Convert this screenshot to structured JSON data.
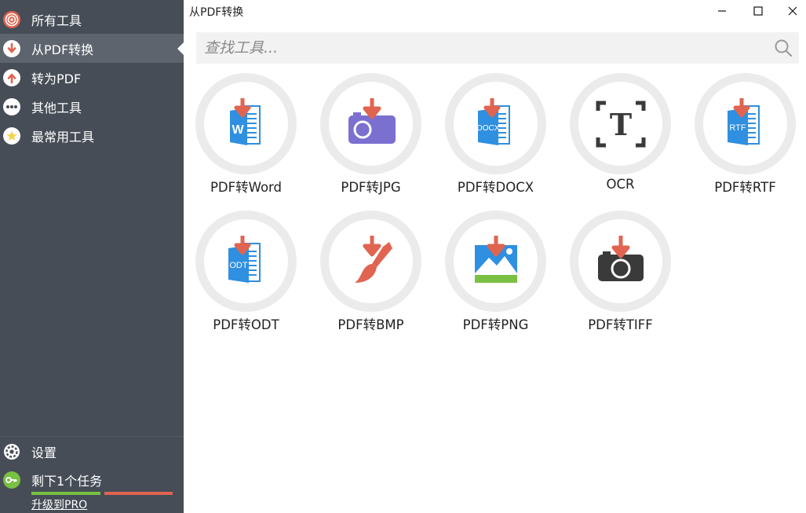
{
  "window": {
    "title": "从PDF转换"
  },
  "sidebar": {
    "items": [
      {
        "label": "所有工具",
        "icon": "target-icon",
        "color": "#e06450"
      },
      {
        "label": "从PDF转换",
        "icon": "arrow-down-icon",
        "color": "#e06450"
      },
      {
        "label": "转为PDF",
        "icon": "arrow-up-icon",
        "color": "#e06450"
      },
      {
        "label": "其他工具",
        "icon": "more-icon",
        "color": "#ffffff"
      },
      {
        "label": "最常用工具",
        "icon": "star-icon",
        "color": "#f5d648"
      }
    ],
    "active_index": 1,
    "settings_label": "设置",
    "tasks_label": "剩下1个任务",
    "upgrade_label": "升级到PRO",
    "tasks_used_fraction": 0.5
  },
  "search": {
    "placeholder": "查找工具..."
  },
  "tools": [
    {
      "label": "PDF转Word",
      "icon": "word-doc-icon"
    },
    {
      "label": "PDF转JPG",
      "icon": "camera-icon"
    },
    {
      "label": "PDF转DOCX",
      "icon": "docx-doc-icon"
    },
    {
      "label": "OCR",
      "icon": "ocr-icon"
    },
    {
      "label": "PDF转RTF",
      "icon": "rtf-doc-icon"
    },
    {
      "label": "PDF转ODT",
      "icon": "odt-doc-icon"
    },
    {
      "label": "PDF转BMP",
      "icon": "brush-icon"
    },
    {
      "label": "PDF转PNG",
      "icon": "image-icon"
    },
    {
      "label": "PDF转TIFF",
      "icon": "camera-dark-icon"
    }
  ],
  "doc_icon_text": {
    "word": "W",
    "docx": "DOCX",
    "rtf": "RTF",
    "odt": "ODT",
    "ocr": "T"
  },
  "colors": {
    "sidebar_bg": "#464d57",
    "active_bg": "#5d646e",
    "accent_red": "#e06450",
    "doc_blue": "#2f8fe0",
    "camera_purple": "#7b6fd0"
  }
}
